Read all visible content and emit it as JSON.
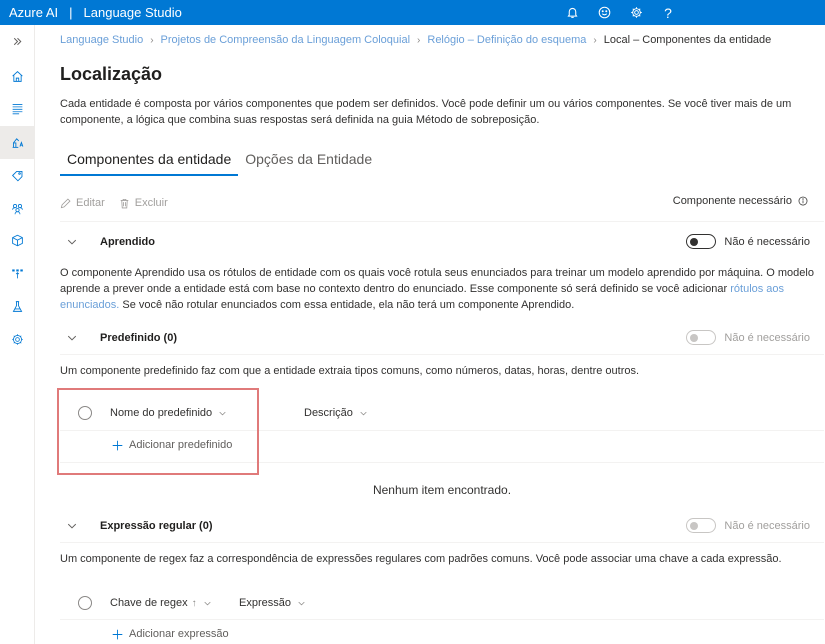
{
  "topbar": {
    "brand": "Azure AI",
    "separator": "|",
    "product": "Language Studio",
    "icons": [
      "bell-icon",
      "smiley-icon",
      "gear-icon",
      "help-icon"
    ],
    "help_glyph": "?"
  },
  "sidebar": {
    "expand_icon": "double-chevron-right-icon",
    "items": [
      {
        "name": "home",
        "icon": "home-icon",
        "active": false
      },
      {
        "name": "data-labeling",
        "icon": "text-lines-icon",
        "active": false
      },
      {
        "name": "schema-definition",
        "icon": "robot-arm-icon",
        "active": true
      },
      {
        "name": "tag",
        "icon": "tag-icon",
        "active": false
      },
      {
        "name": "training",
        "icon": "group-icon",
        "active": false
      },
      {
        "name": "model",
        "icon": "cube-icon",
        "active": false
      },
      {
        "name": "deploy",
        "icon": "deploy-icon",
        "active": false
      },
      {
        "name": "test",
        "icon": "flask-icon",
        "active": false
      },
      {
        "name": "settings",
        "icon": "gear-icon",
        "active": false
      }
    ]
  },
  "breadcrumb": [
    {
      "label": "Language Studio",
      "current": false
    },
    {
      "label": "Projetos de Compreensão da Linguagem Coloquial",
      "current": false
    },
    {
      "label": "Relógio – Definição do esquema",
      "current": false
    },
    {
      "label": "Local – Componentes da entidade",
      "current": true
    }
  ],
  "page": {
    "title": "Localização",
    "description": "Cada entidade é composta por vários componentes que podem ser definidos. Você pode definir um ou vários componentes. Se você tiver mais de um componente, a lógica que combina suas respostas será definida na guia Método de sobreposição."
  },
  "tabs": [
    {
      "label": "Componentes da entidade",
      "active": true
    },
    {
      "label": "Opções da Entidade",
      "active": false
    }
  ],
  "commandbar": {
    "edit_label": "Editar",
    "delete_label": "Excluir",
    "required_label": "Componente necessário"
  },
  "sections": {
    "learned": {
      "title": "Aprendido",
      "toggle_label": "Não é necessário",
      "toggle_on": false,
      "toggle_disabled": false,
      "desc_before_link": "O componente Aprendido usa os rótulos de entidade com os quais você rotula seus enunciados para treinar um modelo aprendido por máquina. O modelo aprende a prever onde a entidade está com base no contexto dentro do enunciado. Esse componente só será definido se você adicionar ",
      "desc_link": "rótulos aos enunciados.",
      "desc_after_link": " Se você não rotular enunciados com essa entidade, ela não terá um componente Aprendido."
    },
    "prebuilt": {
      "title": "Predefinido (0)",
      "toggle_label": "Não é necessário",
      "toggle_on": false,
      "toggle_disabled": true,
      "description": "Um componente predefinido faz com que a entidade extraia tipos comuns, como números, datas, horas, dentre outros.",
      "columns": [
        {
          "label": "Nome do predefinido"
        },
        {
          "label": "Descrição"
        }
      ],
      "add_label": "Adicionar predefinido",
      "empty_message": "Nenhum item encontrado."
    },
    "regex": {
      "title": "Expressão regular (0)",
      "toggle_label": "Não é necessário",
      "toggle_on": false,
      "toggle_disabled": true,
      "description": "Um componente de regex faz a correspondência de expressões regulares com padrões comuns. Você pode associar uma chave a cada expressão.",
      "columns": [
        {
          "label": "Chave de regex",
          "sort_glyph": "↑"
        },
        {
          "label": "Expressão"
        }
      ],
      "add_label": "Adicionar expressão"
    }
  },
  "colors": {
    "brand_blue": "#0078d4",
    "link_blue": "#6a9fd8",
    "highlight_red": "#e07a7a",
    "active_nav_bg": "#edebe9"
  }
}
